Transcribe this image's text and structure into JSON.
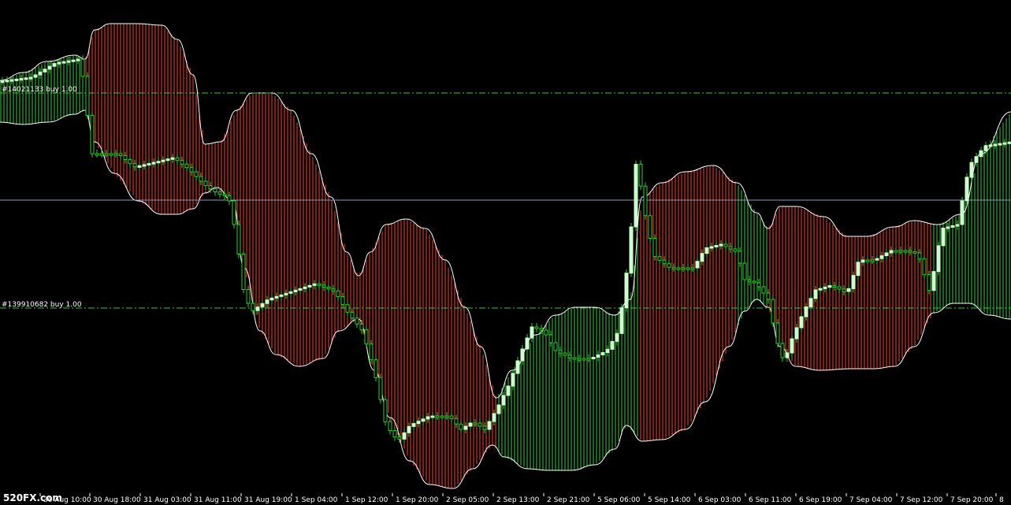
{
  "watermark": "520FX.com",
  "orders": [
    {
      "label": "#14021133 buy 1.00",
      "price_level": "upper"
    },
    {
      "label": "#139910682 buy 1.00",
      "price_level": "lower"
    }
  ],
  "colors": {
    "background": "#000000",
    "envelope_line": "#ffffff",
    "bear_fill": "#ff3b30",
    "bull_fill": "#33cc33",
    "candle_bull": "#ccffcc",
    "order_line": "#33cc33",
    "bid_line": "#8a9bb0",
    "axis_text": "#ffffff"
  },
  "x_axis_labels": [
    "30 Aug 10:00",
    "30 Aug 18:00",
    "31 Aug 03:00",
    "31 Aug 11:00",
    "31 Aug 19:00",
    "1 Sep 04:00",
    "1 Sep 12:00",
    "1 Sep 20:00",
    "2 Sep 05:00",
    "2 Sep 13:00",
    "2 Sep 21:00",
    "5 Sep 06:00",
    "5 Sep 14:00",
    "6 Sep 03:00",
    "6 Sep 11:00",
    "6 Sep 19:00",
    "7 Sep 04:00",
    "7 Sep 12:00",
    "7 Sep 20:00",
    "8"
  ]
}
